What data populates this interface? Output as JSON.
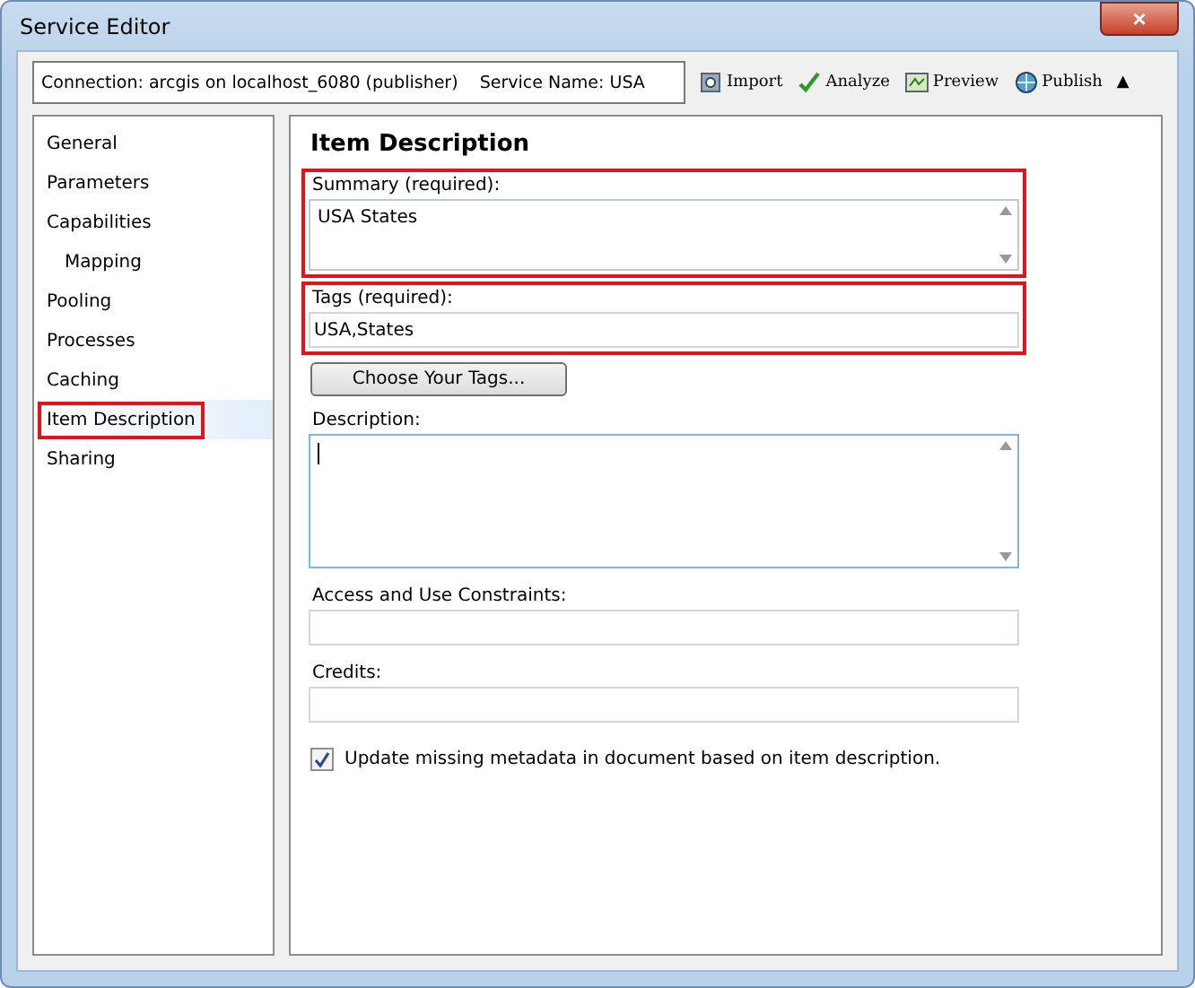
{
  "window": {
    "title": "Service Editor",
    "close_label": "×"
  },
  "toolbar": {
    "connection": "Connection: arcgis on localhost_6080 (publisher)    Service Name: USA",
    "buttons": [
      {
        "kind": "import",
        "label": "Import"
      },
      {
        "kind": "analyze",
        "label": "Analyze"
      },
      {
        "kind": "preview",
        "label": "Preview"
      },
      {
        "kind": "publish",
        "label": "Publish"
      }
    ],
    "collapse_label": "▲"
  },
  "sidebar": {
    "items": [
      {
        "label": "General",
        "selected": false,
        "highlighted": false
      },
      {
        "label": "Parameters",
        "selected": false,
        "highlighted": false
      },
      {
        "label": "Capabilities",
        "selected": false,
        "highlighted": false,
        "children": [
          {
            "label": "Mapping",
            "selected": false,
            "highlighted": false
          }
        ]
      },
      {
        "label": "Pooling",
        "selected": false,
        "highlighted": false
      },
      {
        "label": "Processes",
        "selected": false,
        "highlighted": false
      },
      {
        "label": "Caching",
        "selected": false,
        "highlighted": false
      },
      {
        "label": "Item Description",
        "selected": true,
        "highlighted": true
      },
      {
        "label": "Sharing",
        "selected": false,
        "highlighted": false
      }
    ]
  },
  "content": {
    "heading": "Item Description",
    "fields": [
      {
        "kind": "textarea",
        "label": "Summary (required):",
        "value": "USA States",
        "highlighted": true,
        "focused": false
      },
      {
        "kind": "input",
        "label": "Tags (required):",
        "value": "USA,States",
        "highlighted": true,
        "focused": false
      },
      {
        "kind": "button",
        "label": "Choose Your Tags..."
      },
      {
        "kind": "textarea",
        "label": "Description:",
        "highlighted": false,
        "focused": true
      },
      {
        "kind": "input",
        "label": "Access and Use Constraints:",
        "highlighted": false,
        "focused": false
      },
      {
        "kind": "input",
        "label": "Credits:",
        "highlighted": false,
        "focused": false
      },
      {
        "kind": "checkbox",
        "label": "Update missing metadata in document based on item description.",
        "checked": true
      }
    ]
  }
}
